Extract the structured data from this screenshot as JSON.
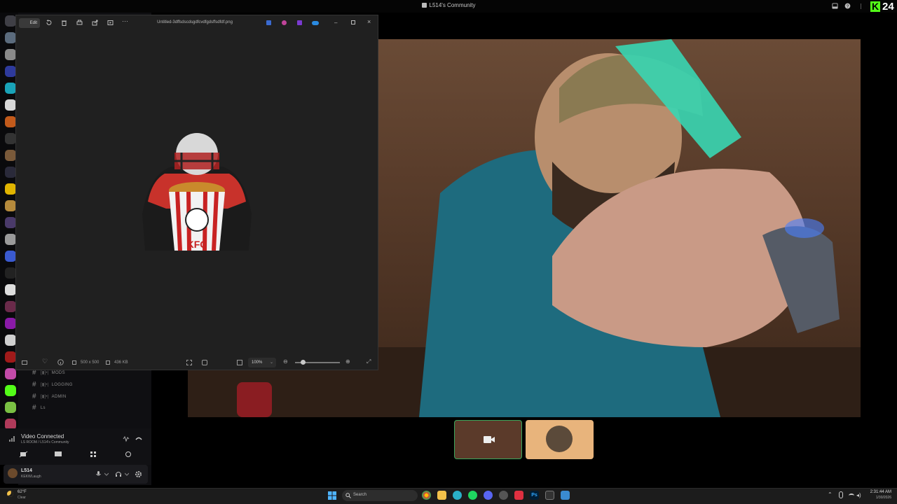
{
  "app": {
    "window_title": "L514's Community"
  },
  "brand": {
    "letter": "K",
    "number": "24",
    "color": "#53fc18"
  },
  "sidebar": {
    "channels": [
      {
        "label": "MODS"
      },
      {
        "label": "LOGGING"
      },
      {
        "label": "ADMIN"
      },
      {
        "label": "Ls"
      }
    ]
  },
  "voice": {
    "status": "Video Connected",
    "room": "LS ROOM / L514's Community"
  },
  "user": {
    "name": "L514",
    "status": "KEKWLaugh"
  },
  "viewer": {
    "edit_label": "Edit",
    "filename": "Untitled-3dffsdscdsgdfcvdfgdsffsdfdf.png",
    "dimensions": "500 x 500",
    "filesize": "436 KB",
    "zoom": "100%",
    "image_text": "KFC"
  },
  "taskbar": {
    "weather_temp": "62°F",
    "weather_cond": "Clear",
    "search_placeholder": "Search",
    "time": "2:31:44 AM",
    "date": "1/30/2026"
  }
}
